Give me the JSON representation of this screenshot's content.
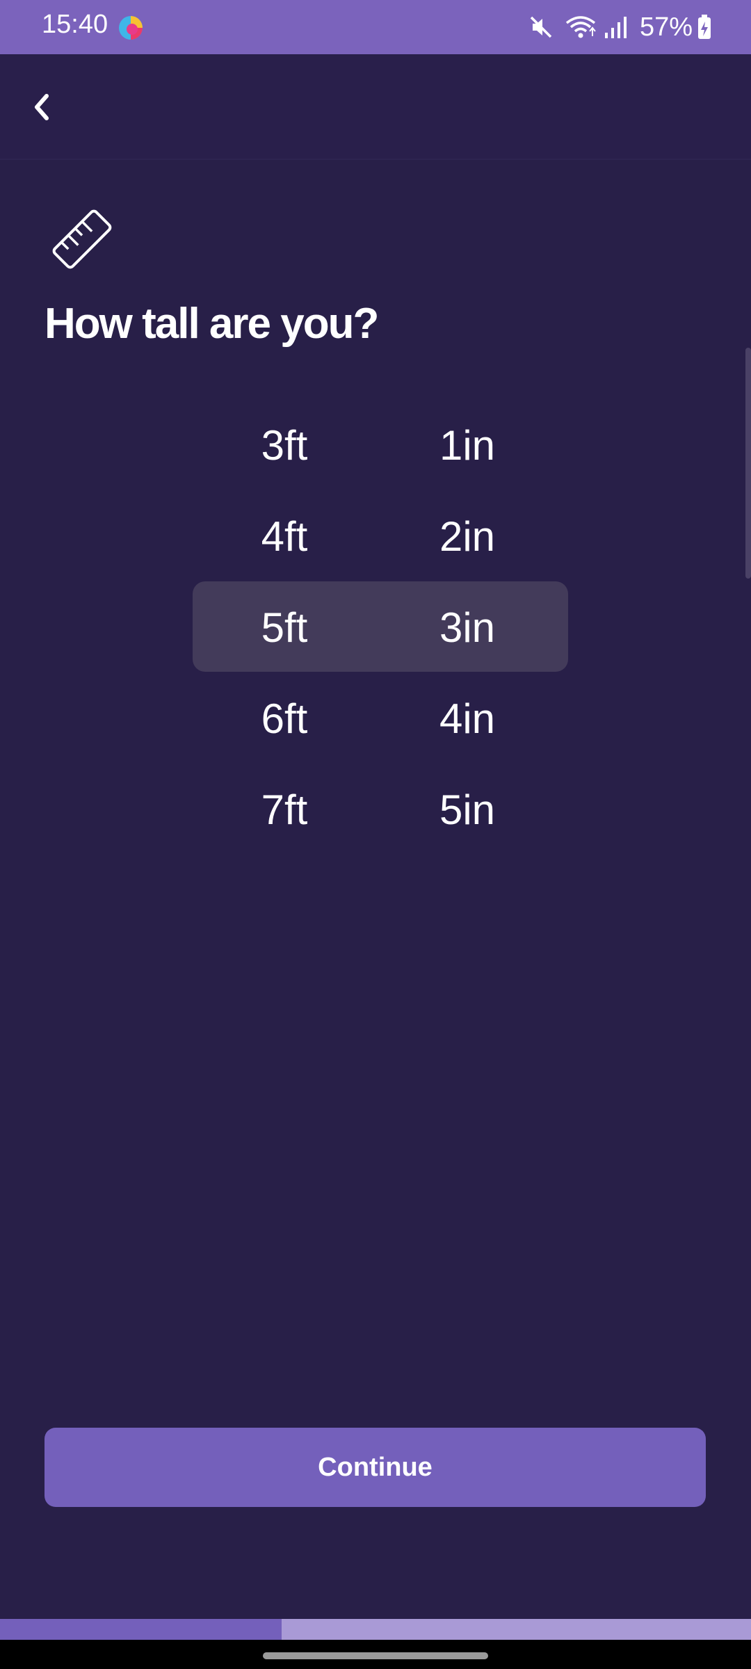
{
  "status_bar": {
    "time": "15:40",
    "battery": "57%",
    "icons": [
      "app-notification-icon",
      "mute-icon",
      "wifi-icon",
      "signal-icon",
      "battery-charging-icon"
    ]
  },
  "header": {
    "back_icon": "chevron-left-icon"
  },
  "main": {
    "icon": "ruler-icon",
    "title": "How tall are you?",
    "picker": {
      "feet": [
        "3ft",
        "4ft",
        "5ft",
        "6ft",
        "7ft"
      ],
      "inches": [
        "1in",
        "2in",
        "3in",
        "4in",
        "5in"
      ],
      "selected_feet": "5ft",
      "selected_inches": "3in"
    }
  },
  "footer": {
    "continue_label": "Continue",
    "progress_fraction": 0.375
  },
  "colors": {
    "background": "#281f48",
    "status_bar": "#7b63bc",
    "accent": "#7460bb",
    "picker_highlight": "#433b5a",
    "progress_track": "#a99ad6"
  }
}
